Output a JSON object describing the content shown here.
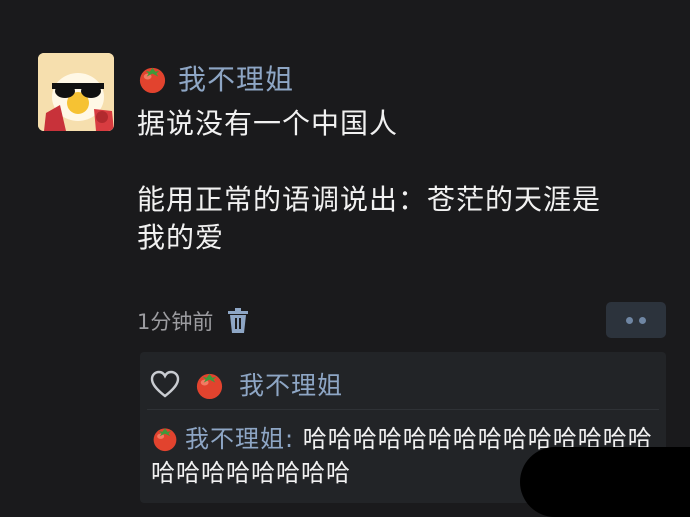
{
  "post": {
    "username": "我不理姐",
    "line1": "据说没有一个中国人",
    "line2": "能用正常的语调说出：苍茫的天涯是",
    "line3": "我的爱",
    "time": "1分钟前"
  },
  "reply": {
    "like_username": "我不理姐",
    "author": "我不理姐",
    "separator": ":",
    "text": " 哈哈哈哈哈哈哈哈哈哈哈哈哈哈哈哈哈哈哈哈哈哈"
  },
  "icons": {
    "avatar": "avatar-duck-sunglasses",
    "badge": "tomato-icon",
    "delete": "trash-icon",
    "more": "more-icon",
    "like": "heart-outline-icon"
  },
  "colors": {
    "background": "#1a1a1c",
    "username": "#8ea6c5",
    "reply_box": "#222427",
    "more_button": "#2c333c"
  }
}
